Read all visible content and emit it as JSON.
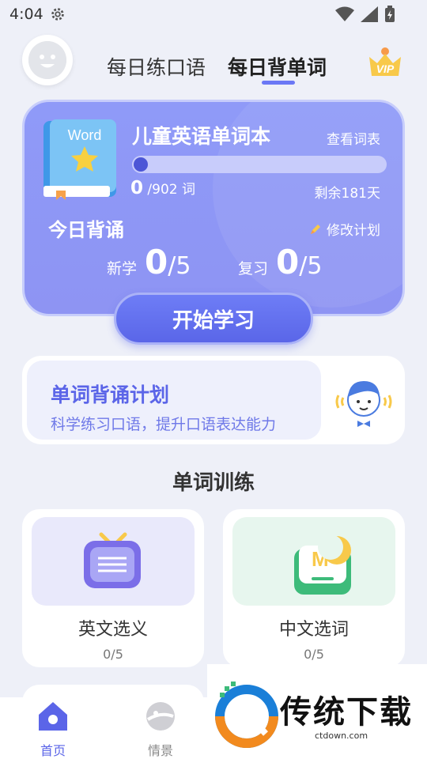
{
  "status_bar": {
    "time": "4:04"
  },
  "header": {
    "tabs": [
      {
        "label": "每日练口语",
        "active": false
      },
      {
        "label": "每日背单词",
        "active": true
      }
    ],
    "vip_label": "VIP"
  },
  "hero": {
    "book_label": "Word",
    "title": "儿童英语单词本",
    "view_list": "查看词表",
    "learned": "0",
    "total": "/902 词",
    "progress_fraction": 0.0,
    "remaining": "剩余181天",
    "today_title": "今日背诵",
    "modify_plan": "修改计划",
    "new_label": "新学",
    "new_done": "0",
    "new_goal": "/5",
    "review_label": "复习",
    "review_done": "0",
    "review_goal": "/5",
    "start_button": "开始学习"
  },
  "plan": {
    "title": "单词背诵计划",
    "subtitle": "科学练习口语，提升口语表达能力"
  },
  "training": {
    "title": "单词训练",
    "cards": [
      {
        "name": "英文选义",
        "progress": "0/5"
      },
      {
        "name": "中文选词",
        "progress": "0/5"
      }
    ]
  },
  "bottom_nav": {
    "items": [
      {
        "label": "首页",
        "active": true
      },
      {
        "label": "情景",
        "active": false
      }
    ]
  },
  "watermark": {
    "text": "传统下载",
    "url": "ctdown.com"
  },
  "colors": {
    "accent": "#5b65e8",
    "hero_bg": "#8f9af8",
    "page_bg": "#eef0f8"
  }
}
